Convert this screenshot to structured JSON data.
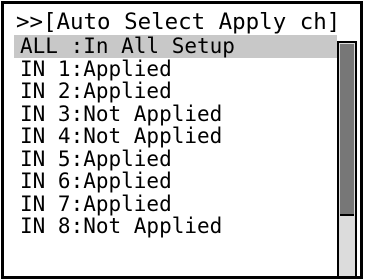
{
  "window": {
    "title": ">>[Auto Select Apply ch]"
  },
  "list": {
    "items": [
      {
        "label": "ALL :In All Setup",
        "selected": true
      },
      {
        "label": "IN 1:Applied",
        "selected": false
      },
      {
        "label": "IN 2:Applied",
        "selected": false
      },
      {
        "label": "IN 3:Not Applied",
        "selected": false
      },
      {
        "label": "IN 4:Not Applied",
        "selected": false
      },
      {
        "label": "IN 5:Applied",
        "selected": false
      },
      {
        "label": "IN 6:Applied",
        "selected": false
      },
      {
        "label": "IN 7:Applied",
        "selected": false
      },
      {
        "label": "IN 8:Not Applied",
        "selected": false
      }
    ]
  },
  "scroll": {
    "position_fraction": 0.0,
    "visible_fraction": 0.7
  },
  "colors": {
    "selection": "#c8c8c8",
    "thumb": "#777777",
    "track": "#dcdcdc"
  }
}
